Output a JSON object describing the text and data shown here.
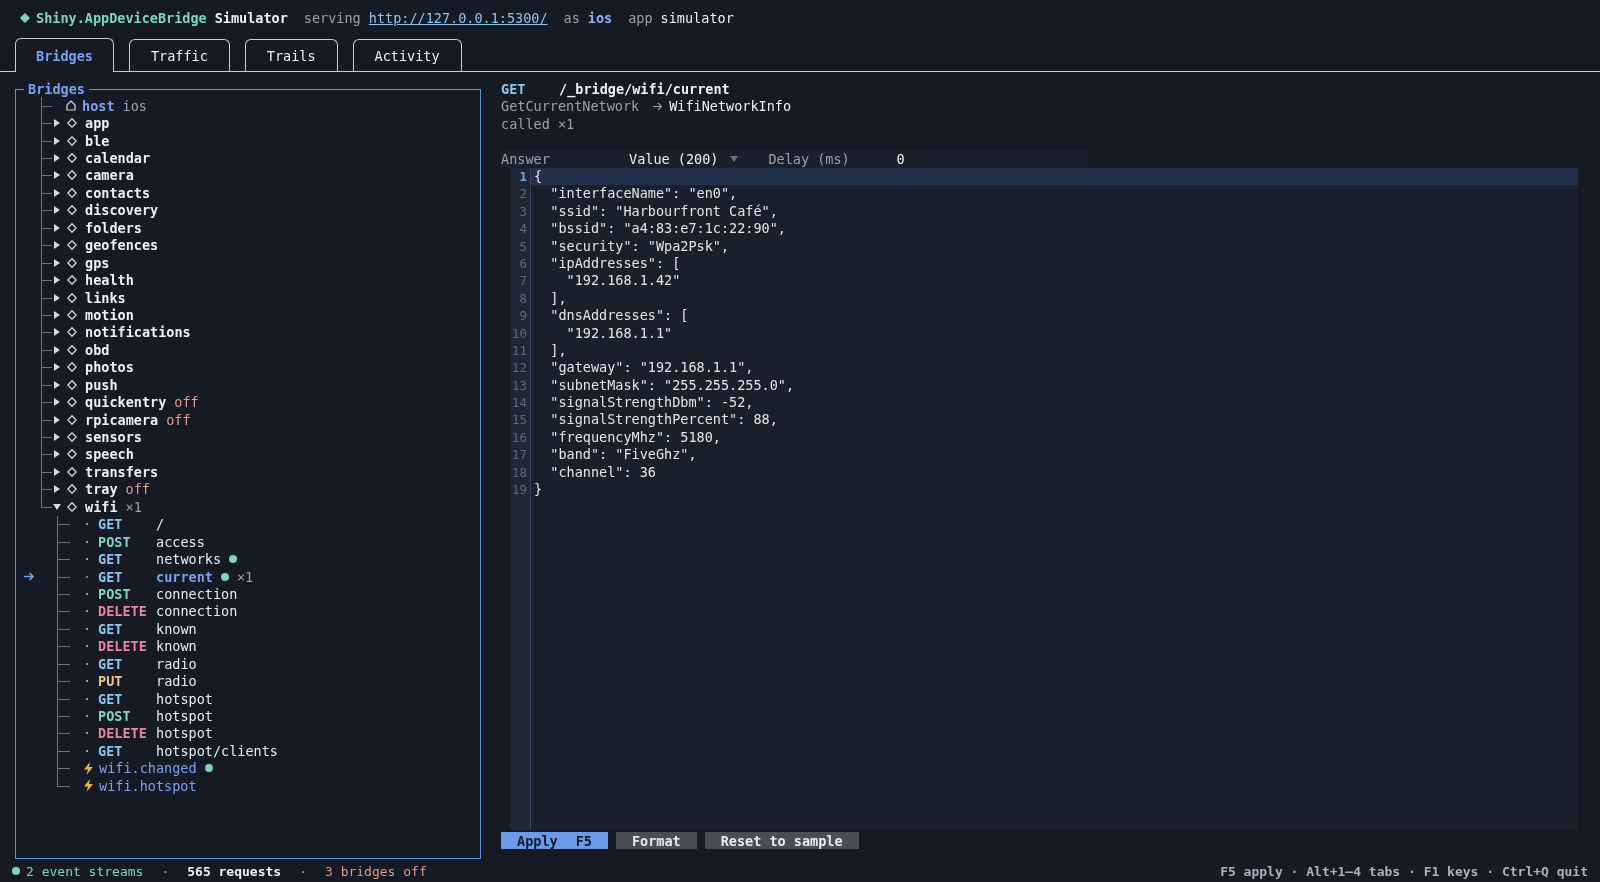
{
  "header": {
    "brand": "Shiny.AppDeviceBridge",
    "product": "Simulator",
    "serving_label": "serving",
    "url": "http://127.0.0.1:5300/",
    "as_label": "as",
    "platform": "ios",
    "app_label": "app",
    "app_value": "simulator"
  },
  "tabs": [
    {
      "label": "Bridges",
      "selected": true
    },
    {
      "label": "Traffic",
      "selected": false
    },
    {
      "label": "Trails",
      "selected": false
    },
    {
      "label": "Activity",
      "selected": false
    }
  ],
  "tree": {
    "title": "Bridges",
    "host": {
      "label": "host",
      "value": "ios"
    },
    "bridges": [
      {
        "name": "app",
        "expanded": false
      },
      {
        "name": "ble",
        "expanded": false
      },
      {
        "name": "calendar",
        "expanded": false
      },
      {
        "name": "camera",
        "expanded": false
      },
      {
        "name": "contacts",
        "expanded": false
      },
      {
        "name": "discovery",
        "expanded": false
      },
      {
        "name": "folders",
        "expanded": false
      },
      {
        "name": "geofences",
        "expanded": false
      },
      {
        "name": "gps",
        "expanded": false
      },
      {
        "name": "health",
        "expanded": false
      },
      {
        "name": "links",
        "expanded": false
      },
      {
        "name": "motion",
        "expanded": false
      },
      {
        "name": "notifications",
        "expanded": false
      },
      {
        "name": "obd",
        "expanded": false
      },
      {
        "name": "photos",
        "expanded": false
      },
      {
        "name": "push",
        "expanded": false
      },
      {
        "name": "quickentry",
        "expanded": false,
        "status": "off"
      },
      {
        "name": "rpicamera",
        "expanded": false,
        "status": "off"
      },
      {
        "name": "sensors",
        "expanded": false
      },
      {
        "name": "speech",
        "expanded": false
      },
      {
        "name": "transfers",
        "expanded": false
      },
      {
        "name": "tray",
        "expanded": false,
        "status": "off"
      },
      {
        "name": "wifi",
        "expanded": true,
        "count": "×1",
        "children": [
          {
            "kind": "endpoint",
            "method": "GET",
            "color": "#8ec5ee",
            "path": "/",
            "live": false,
            "selected": false
          },
          {
            "kind": "endpoint",
            "method": "POST",
            "color": "#86d6c6",
            "path": "access",
            "live": false,
            "selected": false
          },
          {
            "kind": "endpoint",
            "method": "GET",
            "color": "#8ec5ee",
            "path": "networks",
            "live": true,
            "selected": false
          },
          {
            "kind": "endpoint",
            "method": "GET",
            "color": "#8ec5ee",
            "path": "current",
            "live": true,
            "selected": true,
            "count": "×1"
          },
          {
            "kind": "endpoint",
            "method": "POST",
            "color": "#86d6c6",
            "path": "connection",
            "live": false,
            "selected": false
          },
          {
            "kind": "endpoint",
            "method": "DELETE",
            "color": "#e58a9e",
            "path": "connection",
            "live": false,
            "selected": false
          },
          {
            "kind": "endpoint",
            "method": "GET",
            "color": "#8ec5ee",
            "path": "known",
            "live": false,
            "selected": false
          },
          {
            "kind": "endpoint",
            "method": "DELETE",
            "color": "#e58a9e",
            "path": "known",
            "live": false,
            "selected": false
          },
          {
            "kind": "endpoint",
            "method": "GET",
            "color": "#8ec5ee",
            "path": "radio",
            "live": false,
            "selected": false
          },
          {
            "kind": "endpoint",
            "method": "PUT",
            "color": "#f0c38e",
            "path": "radio",
            "live": false,
            "selected": false
          },
          {
            "kind": "endpoint",
            "method": "GET",
            "color": "#8ec5ee",
            "path": "hotspot",
            "live": false,
            "selected": false
          },
          {
            "kind": "endpoint",
            "method": "POST",
            "color": "#86d6c6",
            "path": "hotspot",
            "live": false,
            "selected": false
          },
          {
            "kind": "endpoint",
            "method": "DELETE",
            "color": "#e58a9e",
            "path": "hotspot",
            "live": false,
            "selected": false
          },
          {
            "kind": "endpoint",
            "method": "GET",
            "color": "#8ec5ee",
            "path": "hotspot/clients",
            "live": false,
            "selected": false
          },
          {
            "kind": "event",
            "name": "wifi.changed",
            "live": true
          },
          {
            "kind": "event",
            "name": "wifi.hotspot",
            "live": false
          }
        ]
      }
    ]
  },
  "detail": {
    "method": "GET",
    "path": "/_bridge/wifi/current",
    "handler": "GetCurrentNetwork",
    "returns": "WifiNetworkInfo",
    "called": "called ×1"
  },
  "answer": {
    "label": "Answer",
    "value": "Value (200)",
    "delay_label": "Delay (ms)",
    "delay": "0"
  },
  "editor": {
    "lines": [
      {
        "n": "1",
        "code": "{",
        "current": true
      },
      {
        "n": "2",
        "code": "  \"interfaceName\": \"en0\",",
        "current": false
      },
      {
        "n": "3",
        "code": "  \"ssid\": \"Harbourfront Café\",",
        "current": false
      },
      {
        "n": "4",
        "code": "  \"bssid\": \"a4:83:e7:1c:22:90\",",
        "current": false
      },
      {
        "n": "5",
        "code": "  \"security\": \"Wpa2Psk\",",
        "current": false
      },
      {
        "n": "6",
        "code": "  \"ipAddresses\": [",
        "current": false
      },
      {
        "n": "7",
        "code": "    \"192.168.1.42\"",
        "current": false
      },
      {
        "n": "8",
        "code": "  ],",
        "current": false
      },
      {
        "n": "9",
        "code": "  \"dnsAddresses\": [",
        "current": false
      },
      {
        "n": "10",
        "code": "    \"192.168.1.1\"",
        "current": false
      },
      {
        "n": "11",
        "code": "  ],",
        "current": false
      },
      {
        "n": "12",
        "code": "  \"gateway\": \"192.168.1.1\",",
        "current": false
      },
      {
        "n": "13",
        "code": "  \"subnetMask\": \"255.255.255.0\",",
        "current": false
      },
      {
        "n": "14",
        "code": "  \"signalStrengthDbm\": -52,",
        "current": false
      },
      {
        "n": "15",
        "code": "  \"signalStrengthPercent\": 88,",
        "current": false
      },
      {
        "n": "16",
        "code": "  \"frequencyMhz\": 5180,",
        "current": false
      },
      {
        "n": "17",
        "code": "  \"band\": \"FiveGhz\",",
        "current": false
      },
      {
        "n": "18",
        "code": "  \"channel\": 36",
        "current": false
      },
      {
        "n": "19",
        "code": "}",
        "current": false
      }
    ]
  },
  "buttons": [
    {
      "label": "Apply",
      "key": "F5",
      "primary": true
    },
    {
      "label": "Format",
      "primary": false
    },
    {
      "label": "Reset to sample",
      "primary": false
    }
  ],
  "status_bar": {
    "separator": "·",
    "items": [
      {
        "text": "2 event streams",
        "kind": "streams"
      },
      {
        "text": "565 requests",
        "kind": "requests"
      },
      {
        "text": "3 bridges off",
        "kind": "off"
      }
    ],
    "keys": "F5 apply · Alt+1–4 tabs · F1 keys · Ctrl+Q quit"
  }
}
